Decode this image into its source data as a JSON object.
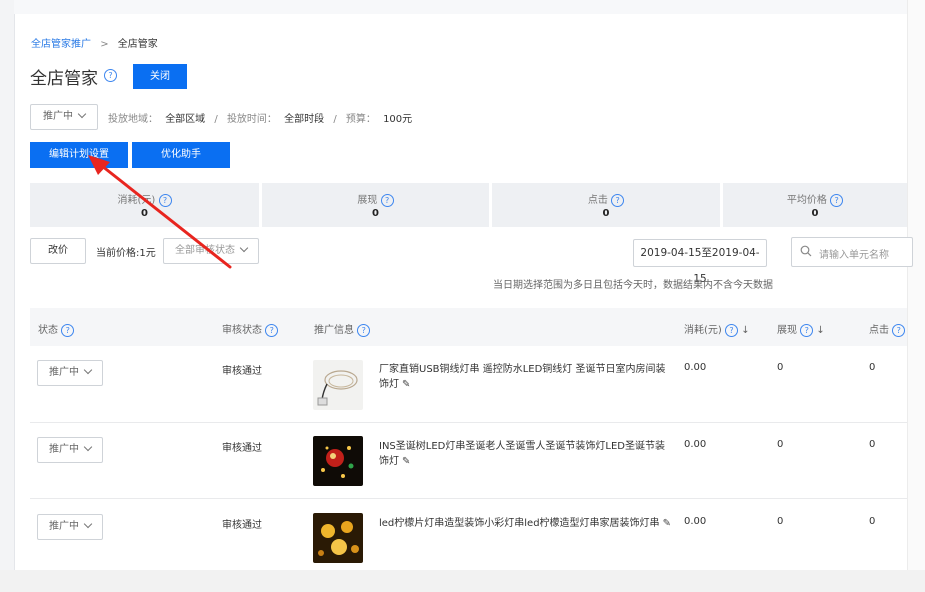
{
  "breadcrumb": {
    "parent": "全店管家推广",
    "separator": ">",
    "current": "全店管家"
  },
  "header": {
    "title": "全店管家",
    "help_icon": "?",
    "close_label": "关闭"
  },
  "filters": {
    "status_select": "推广中",
    "region_label": "投放地域：",
    "region_value": "全部区域",
    "time_label": "投放时间：",
    "time_value": "全部时段",
    "budget_label": "预算：",
    "budget_value": "100元",
    "sep": "/"
  },
  "actions": {
    "edit_plan": "编辑计划设置",
    "optimize": "优化助手"
  },
  "stats": [
    {
      "label": "消耗(元)",
      "value": "0"
    },
    {
      "label": "展现",
      "value": "0"
    },
    {
      "label": "点击",
      "value": "0"
    },
    {
      "label": "平均价格",
      "value": "0"
    }
  ],
  "toolbar": {
    "change_price": "改价",
    "current_price": "当前价格:1元",
    "audit_select": "全部审核状态",
    "date_range": "2019-04-15至2019-04-15",
    "search_placeholder": "请输入单元名称",
    "date_note": "当日期选择范围为多日且包括今天时，数据结果内不含今天数据"
  },
  "table": {
    "headers": {
      "status": "状态",
      "audit": "审核状态",
      "info": "推广信息",
      "cost": "消耗(元)",
      "impressions": "展现",
      "clicks": "点击"
    },
    "rows": [
      {
        "status": "推广中",
        "audit": "审核通过",
        "title": "厂家直销USB铜线灯串 遥控防水LED铜线灯 圣诞节日室内房间装饰灯",
        "cost": "0.00",
        "impressions": "0",
        "clicks": "0"
      },
      {
        "status": "推广中",
        "audit": "审核通过",
        "title": "INS圣诞树LED灯串圣诞老人圣诞雪人圣诞节装饰灯LED圣诞节装饰灯",
        "cost": "0.00",
        "impressions": "0",
        "clicks": "0"
      },
      {
        "status": "推广中",
        "audit": "审核通过",
        "title": "led柠檬片灯串造型装饰小彩灯串led柠檬造型灯串家居装饰灯串",
        "cost": "0.00",
        "impressions": "0",
        "clicks": "0"
      }
    ]
  },
  "colors": {
    "accent": "#0a6ff2",
    "arrow": "#e8251f",
    "link": "#2879e5"
  }
}
